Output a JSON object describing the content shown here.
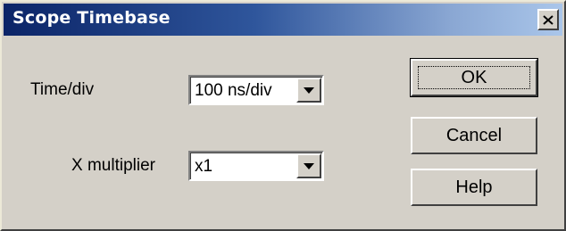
{
  "dialog": {
    "title": "Scope Timebase"
  },
  "time_div": {
    "label": "Time/div",
    "value": "100 ns/div"
  },
  "x_multiplier": {
    "label": "X multiplier",
    "value": "x1"
  },
  "buttons": {
    "ok": "OK",
    "cancel": "Cancel",
    "help": "Help"
  },
  "icons": {
    "close": "close-icon",
    "dropdown": "chevron-down-icon"
  },
  "colors": {
    "titlebar_start": "#0b2467",
    "titlebar_end": "#aac6ea",
    "face": "#d4d0c8"
  }
}
